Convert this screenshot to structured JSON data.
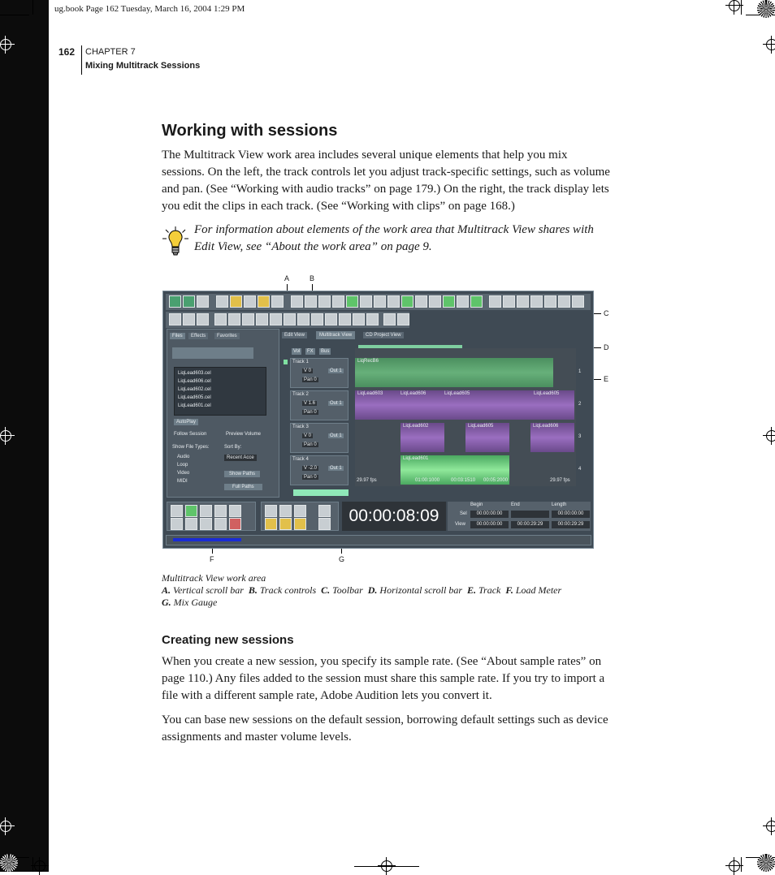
{
  "slug": "ug.book  Page 162  Tuesday, March 16, 2004  1:29 PM",
  "running_head": {
    "page_number": "162",
    "chapter": "CHAPTER 7",
    "section": "Mixing Multitrack Sessions"
  },
  "heading1": "Working with sessions",
  "para1": "The Multitrack View work area includes several unique elements that help you mix sessions. On the left, the track controls let you adjust track-specific settings, such as volume and pan. (See “Working with audio tracks” on page 179.) On the right, the track display lets you edit the clips in each track. (See “Working with clips” on page 168.)",
  "tip": "For information about elements of the work area that Multitrack View shares with Edit View, see “About the work area” on page 9.",
  "figure": {
    "callouts": [
      "A",
      "B",
      "C",
      "D",
      "E",
      "F",
      "G"
    ],
    "tabs": [
      "Edit View",
      "Multitrack View",
      "CD Project View"
    ],
    "organizer_tabs": [
      "Files",
      "Effects",
      "Favorites"
    ],
    "files": [
      "LiqLead603.cel",
      "LiqLead606.cel",
      "LiqLead602.cel",
      "LiqLead605.cel",
      "LiqLead601.cel"
    ],
    "organizer": {
      "auto_play": "AutoPlay",
      "follow": "Follow Session",
      "preview_volume": "Preview Volume",
      "show_file_types": "Show File Types:",
      "sort_by": "Sort By:",
      "sort_value": "Recent Acce",
      "show_types": [
        "Audio",
        "Loop",
        "Video",
        "MIDI"
      ],
      "show_paths": "Show Paths",
      "full_paths": "Full Paths"
    },
    "tracks": [
      {
        "name": "Track 1",
        "vol": "V 0",
        "out": "Out 1",
        "pan": "Pan 0",
        "clips": [
          "LiqRecB6"
        ]
      },
      {
        "name": "Track 2",
        "vol": "V 1.6",
        "out": "Out 1",
        "pan": "Pan 0",
        "clips": [
          "LiqLead603",
          "LiqLead606",
          "LiqLead605",
          "LiqLead605"
        ]
      },
      {
        "name": "Track 3",
        "vol": "V 0",
        "out": "Out 1",
        "pan": "Pan 0",
        "clips": [
          "LiqLead602",
          "LiqLead605",
          "LiqLead606"
        ]
      },
      {
        "name": "Track 4",
        "vol": "V -2.0",
        "out": "Out 1",
        "pan": "Pan 0",
        "clips": [
          "LiqLead601"
        ]
      }
    ],
    "ruler": [
      "29.97 fps",
      "01:00:1000",
      "00:03:1510",
      "00:05:2000",
      "29.97 fps"
    ],
    "track_numbers": [
      "1",
      "2",
      "3",
      "4"
    ],
    "filter_buttons": [
      "Vol",
      "FX",
      "Bus"
    ],
    "time_display": "00:00:08:09",
    "sel_view": {
      "headers": [
        "Begin",
        "End",
        "Length"
      ],
      "sel_label": "Sel",
      "view_label": "View",
      "sel": [
        "00:00:00:00",
        "",
        "00:00:00:00"
      ],
      "view": [
        "00:00:00:00",
        "00:00:29:29",
        "00:00:29:29"
      ]
    }
  },
  "caption": {
    "title": "Multitrack View work area",
    "items": [
      {
        "key": "A.",
        "label": "Vertical scroll bar"
      },
      {
        "key": "B.",
        "label": "Track controls"
      },
      {
        "key": "C.",
        "label": "Toolbar"
      },
      {
        "key": "D.",
        "label": "Horizontal scroll bar"
      },
      {
        "key": "E.",
        "label": "Track"
      },
      {
        "key": "F.",
        "label": "Load Meter"
      },
      {
        "key": "G.",
        "label": "Mix Gauge"
      }
    ]
  },
  "heading2": "Creating new sessions",
  "para2": "When you create a new session, you specify its sample rate. (See “About sample rates” on page 110.) Any files added to the session must share this sample rate. If you try to import a file with a different sample rate, Adobe Audition lets you convert it.",
  "para3": "You can base new sessions on the default session, borrowing default settings such as device assignments and master volume levels."
}
